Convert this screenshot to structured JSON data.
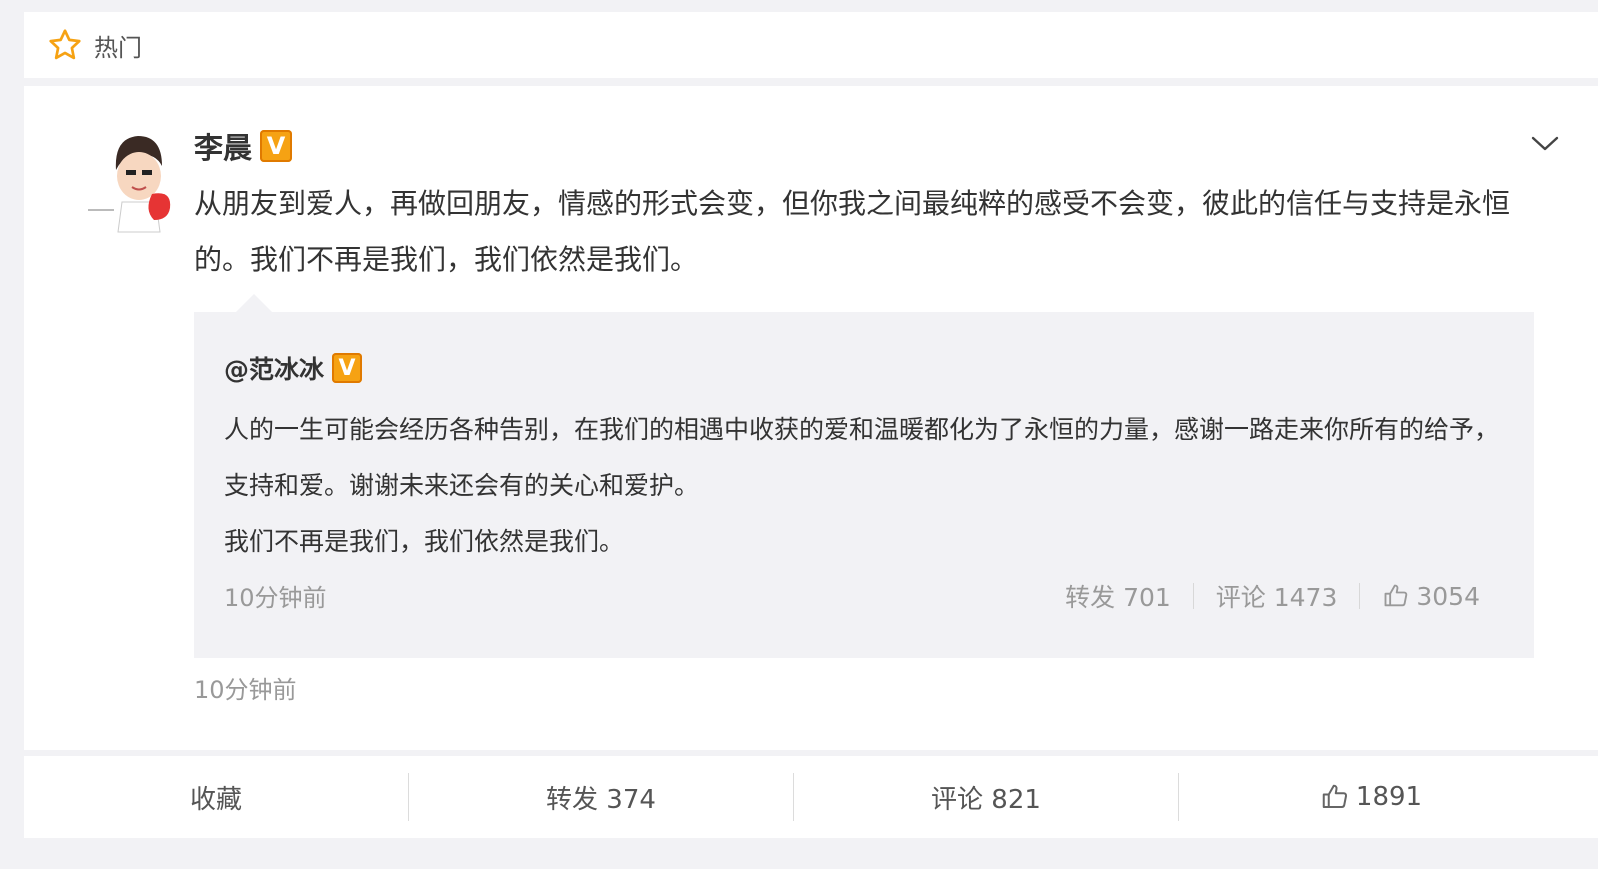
{
  "header": {
    "tag_label": "热门"
  },
  "post": {
    "author": "李晨",
    "verified_badge": "V",
    "text": "从朋友到爱人，再做回朋友，情感的形式会变，但你我之间最纯粹的感受不会变，彼此的信任与支持是永恒的。我们不再是我们，我们依然是我们。",
    "time": "10分钟前",
    "repost": {
      "author": "@范冰冰",
      "verified_badge": "V",
      "paragraphs": [
        "人的一生可能会经历各种告别，在我们的相遇中收获的爱和温暖都化为了永恒的力量，感谢一路走来你所有的给予，支持和爱。谢谢未来还会有的关心和爱护。",
        "我们不再是我们，我们依然是我们。"
      ],
      "time": "10分钟前",
      "forward_label": "转发 701",
      "comment_label": "评论 1473",
      "like_count": "3054"
    }
  },
  "actions": {
    "favorite_label": "收藏",
    "forward_label": "转发 374",
    "comment_label": "评论 821",
    "like_count": "1891"
  },
  "colors": {
    "badge": "#f6a213",
    "muted_text": "#999999",
    "repost_bg": "#f2f2f5"
  },
  "icons": {
    "header": "star-icon",
    "menu": "chevron-down-icon",
    "like": "thumbs-up-icon"
  }
}
